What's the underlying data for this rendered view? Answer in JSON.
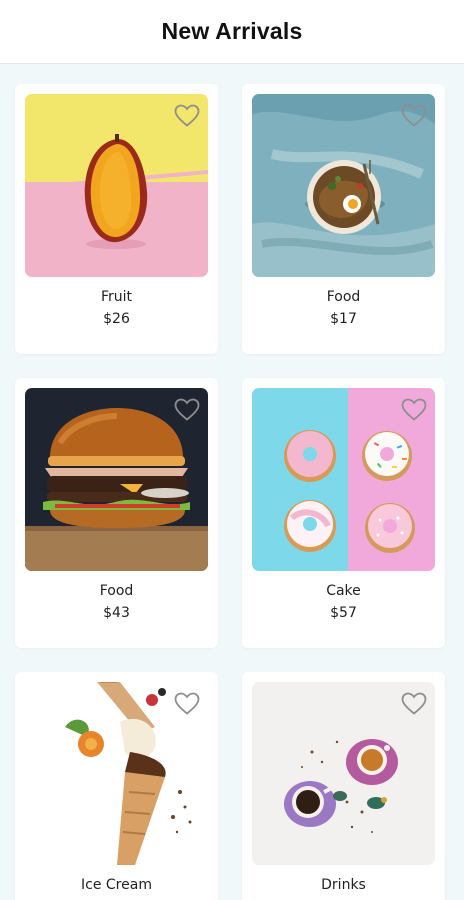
{
  "header": {
    "title": "New Arrivals"
  },
  "products": [
    {
      "name": "Fruit",
      "price": "$26",
      "image": "mango-half-photo"
    },
    {
      "name": "Food",
      "price": "$17",
      "image": "noodle-plate-photo"
    },
    {
      "name": "Food",
      "price": "$43",
      "image": "burger-photo"
    },
    {
      "name": "Cake",
      "price": "$57",
      "image": "donuts-photo"
    },
    {
      "name": "Ice Cream",
      "price": "",
      "image": "ice-cream-cone-photo"
    },
    {
      "name": "Drinks",
      "price": "",
      "image": "tea-cups-photo"
    }
  ],
  "icons": {
    "favorite": "heart-outline-icon"
  },
  "colors": {
    "page_bg": "#f1f8f9",
    "card_bg": "#ffffff",
    "heart": "#8e8e8e"
  }
}
